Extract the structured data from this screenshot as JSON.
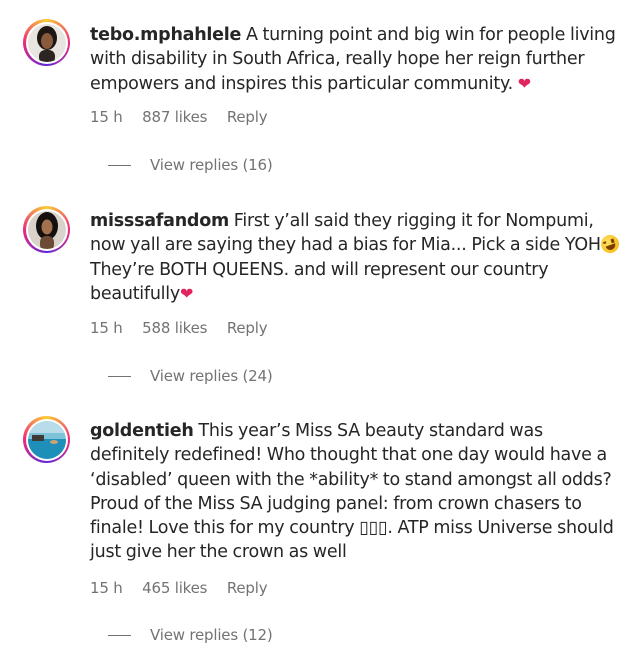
{
  "comments": [
    {
      "username": "tebo.mphahlele",
      "text": "A turning point and big win for people living with disability in South Africa, really hope her reign further empowers and inspires this particular community.",
      "time": "15 h",
      "likes": "887 likes",
      "reply_label": "Reply",
      "view_replies": "View replies (16)"
    },
    {
      "username": "misssafandom",
      "text": "First y’all said they rigging it for Nompumi, now yall are saying they had a bias for Mia... Pick a side YOH",
      "text2": " They’re BOTH QUEENS. and will represent our country beautifully",
      "time": "15 h",
      "likes": "588 likes",
      "reply_label": "Reply",
      "view_replies": "View replies (24)"
    },
    {
      "username": "goldentieh",
      "text": "This year’s Miss SA beauty standard was definitely redefined! Who thought that one day would have a ‘disabled’ queen with the *ability* to stand amongst all odds? Proud of the Miss SA judging panel: from crown chasers to finale! Love this for my country ▯▯▯. ATP miss Universe should just give her the crown as well",
      "time": "15 h",
      "likes": "465 likes",
      "reply_label": "Reply",
      "view_replies": "View replies (12)"
    }
  ],
  "icons": {
    "heart": "red-heart-emoji",
    "laugh": "rolling-laughing-emoji"
  },
  "colors": {
    "text": "#262626",
    "meta": "#737373",
    "heart": "#e0245e"
  }
}
